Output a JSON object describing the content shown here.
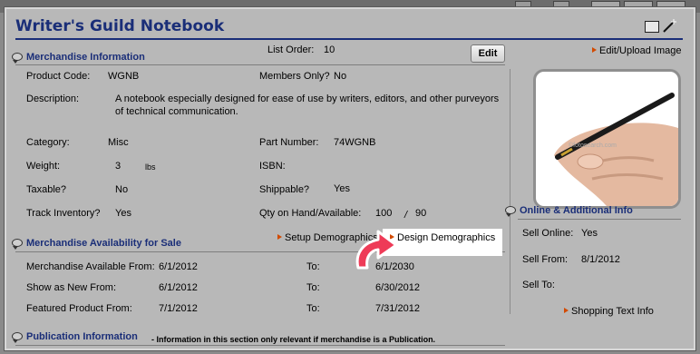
{
  "title": "Writer's Guild Notebook",
  "top_strip_text": "",
  "merch": {
    "section_title": "Merchandise Information",
    "list_order_label": "List Order:",
    "list_order_value": "10",
    "edit_label": "Edit",
    "product_code_label": "Product Code:",
    "product_code_value": "WGNB",
    "members_only_label": "Members Only?",
    "members_only_value": "No",
    "description_label": "Description:",
    "description_line1": "A notebook especially designed for ease of use by writers, editors, and other purveyors",
    "description_line2": "of technical communication.",
    "category_label": "Category:",
    "category_value": "Misc",
    "part_number_label": "Part Number:",
    "part_number_value": "74WGNB",
    "weight_label": "Weight:",
    "weight_value": "3",
    "weight_unit": "lbs",
    "isbn_label": "ISBN:",
    "isbn_value": "",
    "taxable_label": "Taxable?",
    "taxable_value": "No",
    "shippable_label": "Shippable?",
    "shippable_value": "Yes",
    "track_label": "Track Inventory?",
    "track_value": "Yes",
    "qty_label": "Qty on Hand/Available:",
    "qty_on_hand": "100",
    "qty_sep": "/",
    "qty_available": "90"
  },
  "availability": {
    "section_title": "Merchandise Availability for Sale",
    "setup_link": "Setup Demographics",
    "design_link": "Design Demographics",
    "to_label": "To:",
    "rows": [
      {
        "label": "Merchandise Available From:",
        "from": "6/1/2012",
        "to": "6/1/2030"
      },
      {
        "label": "Show as New From:",
        "from": "6/1/2012",
        "to": "6/30/2012"
      },
      {
        "label": "Featured Product From:",
        "from": "7/1/2012",
        "to": "7/31/2012"
      }
    ]
  },
  "publication": {
    "section_title": "Publication Information",
    "note": "- Information in this section only relevant if merchandise is a Publication."
  },
  "sidebar": {
    "edit_image_link": "Edit/Upload Image",
    "image_watermark": "©fotosearch.com",
    "online_title": "Online & Additional Info",
    "sell_online_label": "Sell Online:",
    "sell_online_value": "Yes",
    "sell_from_label": "Sell From:",
    "sell_from_value": "8/1/2012",
    "sell_to_label": "Sell To:",
    "sell_to_value": "",
    "shopping_link": "Shopping Text Info"
  },
  "colors": {
    "title_blue": "#1a2e78",
    "background_gray": "#b8b8b8",
    "link_arrow": "#d24a00",
    "callout_arrow": "#ee3b57"
  }
}
